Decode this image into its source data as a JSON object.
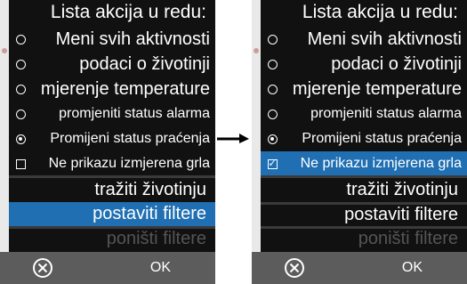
{
  "colors": {
    "panel_bg": "#111111",
    "selected_bg": "#1f6fb2",
    "bottom_bar": "#5c5c5c",
    "disabled_text": "#555555"
  },
  "left": {
    "title": "Lista akcija u redu:",
    "options": [
      {
        "label": "Meni svih aktivnosti",
        "control": "radio",
        "checked": false
      },
      {
        "label": "podaci o životinji",
        "control": "radio",
        "checked": false
      },
      {
        "label": "mjerenje temperature",
        "control": "radio",
        "checked": false
      },
      {
        "label": "promjeniti status alarma",
        "control": "radio",
        "checked": false
      },
      {
        "label": "Promijeni status praćenja",
        "control": "radio",
        "checked": true
      },
      {
        "label": "Ne prikazu izmjerena grla",
        "control": "checkbox",
        "checked": false
      }
    ],
    "actions": [
      {
        "label": "tražiti životinju",
        "state": "normal"
      },
      {
        "label": "postaviti filtere",
        "state": "selected"
      },
      {
        "label": "poništi filtere",
        "state": "disabled"
      }
    ],
    "ok_label": "OK",
    "cancel_icon": "circle-x-icon"
  },
  "right": {
    "title": "Lista akcija u redu:",
    "options": [
      {
        "label": "Meni svih aktivnosti",
        "control": "radio",
        "checked": false
      },
      {
        "label": "podaci o životinji",
        "control": "radio",
        "checked": false
      },
      {
        "label": "mjerenje temperature",
        "control": "radio",
        "checked": false
      },
      {
        "label": "promjeniti status alarma",
        "control": "radio",
        "checked": false
      },
      {
        "label": "Promijeni status praćenja",
        "control": "radio",
        "checked": true
      },
      {
        "label": "Ne prikazu izmjerena grla",
        "control": "checkbox",
        "checked": true,
        "highlighted": true
      }
    ],
    "actions": [
      {
        "label": "tražiti životinju",
        "state": "normal"
      },
      {
        "label": "postaviti filtere",
        "state": "normal"
      },
      {
        "label": "poništi filtere",
        "state": "disabled"
      }
    ],
    "ok_label": "OK",
    "cancel_icon": "circle-x-icon"
  }
}
